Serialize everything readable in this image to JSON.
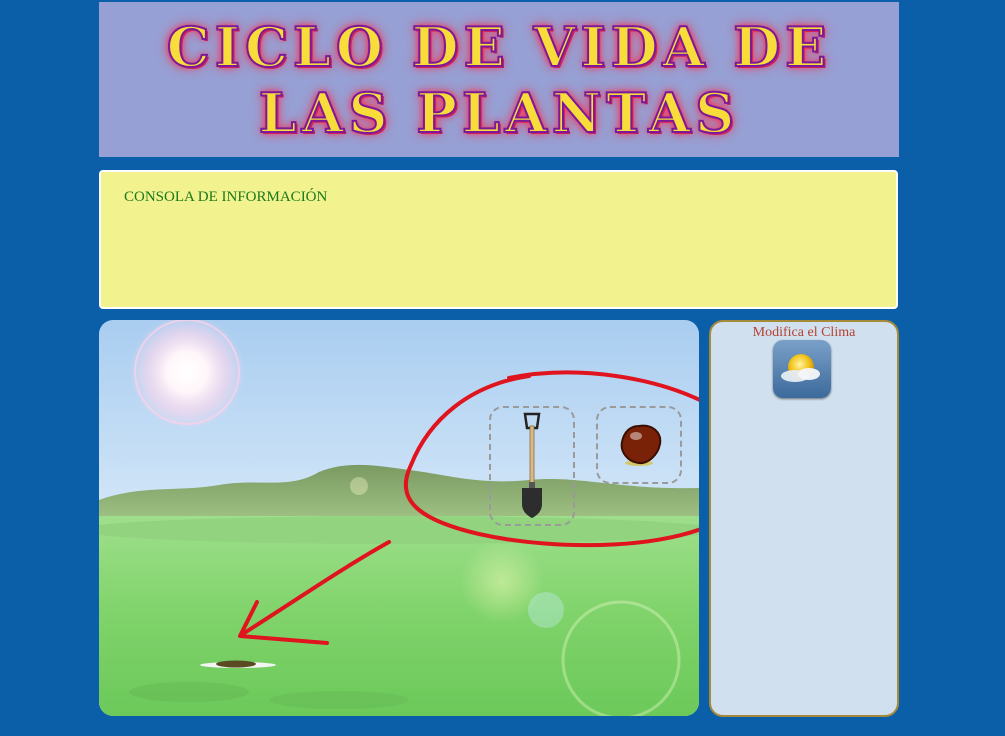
{
  "header": {
    "title": "CICLO DE VIDA DE LAS PLANTAS"
  },
  "console": {
    "title": "CONSOLA DE INFORMACIÓN"
  },
  "scene": {
    "tools": [
      {
        "name": "shovel",
        "icon": "shovel-icon"
      },
      {
        "name": "seed",
        "icon": "seed-icon"
      }
    ],
    "target": {
      "icon": "soil-hole-icon"
    }
  },
  "sidebar": {
    "title": "Modifica el Clima",
    "weather_icon": "sun-cloud-icon"
  },
  "colors": {
    "page_bg": "#0b5ea8",
    "banner_bg": "#97a0d4",
    "console_bg": "#f2f28e",
    "console_text": "#1a7a1a",
    "sidebar_bg": "#d0e0ee",
    "sidebar_title": "#b84030",
    "annotation": "#e0141e"
  }
}
